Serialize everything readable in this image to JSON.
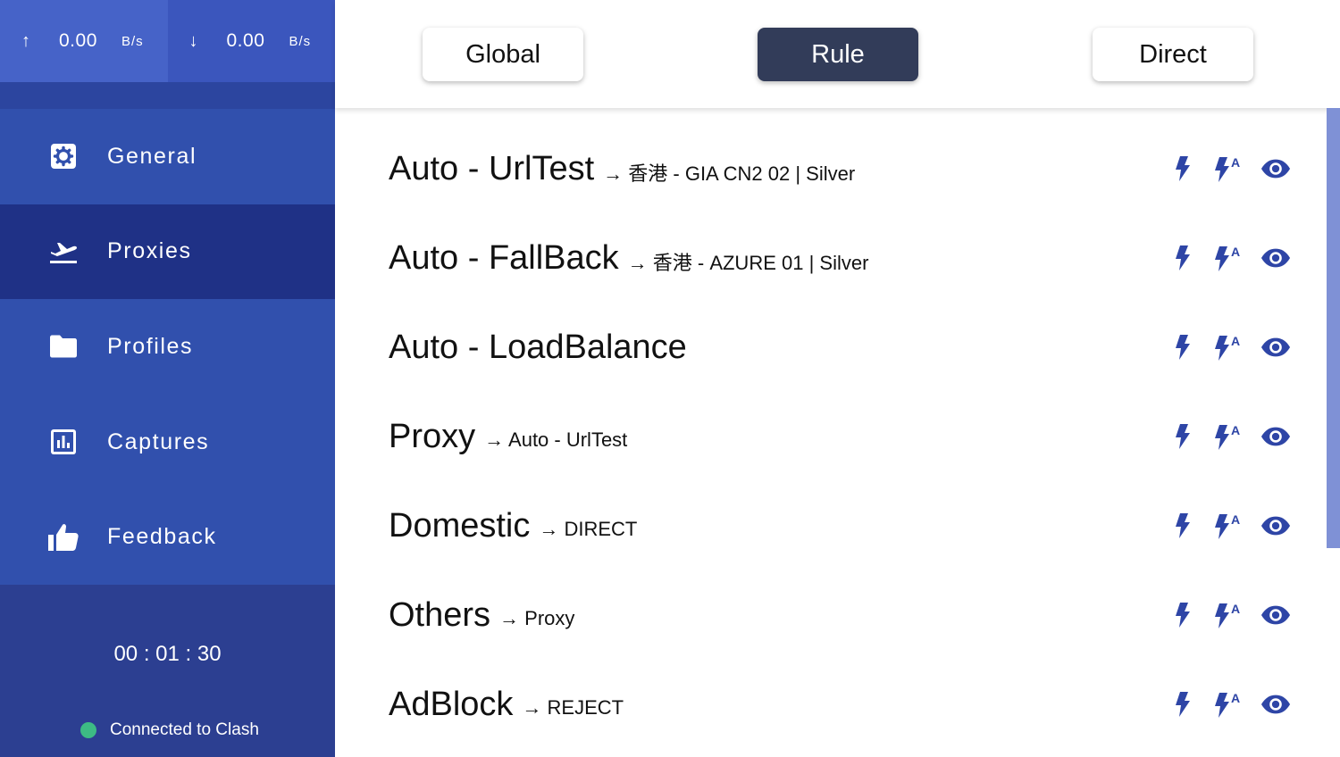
{
  "traffic": {
    "upload": {
      "arrow": "↑",
      "value": "0.00",
      "unit": "B/s"
    },
    "download": {
      "arrow": "↓",
      "value": "0.00",
      "unit": "B/s"
    }
  },
  "nav": {
    "items": [
      {
        "label": "General",
        "icon": "gear-icon"
      },
      {
        "label": "Proxies",
        "icon": "plane-departure-icon"
      },
      {
        "label": "Profiles",
        "icon": "folder-icon"
      },
      {
        "label": "Captures",
        "icon": "bar-chart-icon"
      },
      {
        "label": "Feedback",
        "icon": "thumbs-up-icon"
      }
    ],
    "active": "Proxies"
  },
  "footer": {
    "uptime": "00 : 01 : 30",
    "status": "Connected to Clash"
  },
  "modes": {
    "global": "Global",
    "rule": "Rule",
    "direct": "Direct",
    "active": "Rule"
  },
  "groups": [
    {
      "name": "Auto - UrlTest",
      "selected": "→ 香港 - GIA CN2 02 | Silver"
    },
    {
      "name": "Auto - FallBack",
      "selected": "→ 香港 - AZURE 01 | Silver"
    },
    {
      "name": "Auto - LoadBalance",
      "selected": ""
    },
    {
      "name": "Proxy",
      "selected": "→ Auto - UrlTest"
    },
    {
      "name": "Domestic",
      "selected": "→ DIRECT"
    },
    {
      "name": "Others",
      "selected": "→ Proxy"
    },
    {
      "name": "AdBlock",
      "selected": "→ REJECT"
    }
  ],
  "colors": {
    "sidebar": "#2f4ba8",
    "sidebar_active": "#1f3186",
    "accent_icon": "#2e45a6",
    "mode_active": "#323c59",
    "status_dot": "#3dbb84",
    "scrollbar": "#7f91d6"
  }
}
